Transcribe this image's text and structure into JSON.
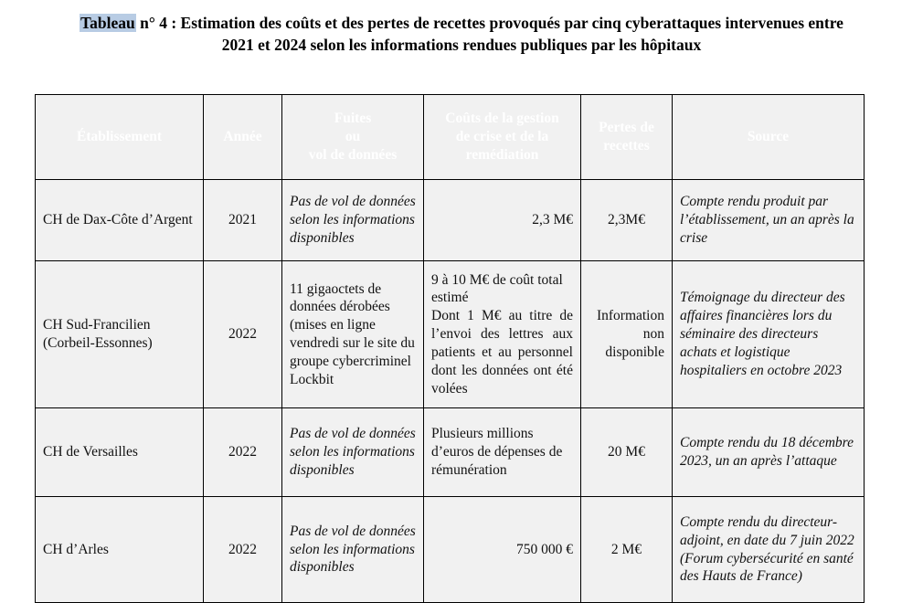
{
  "caption": {
    "highlight_word": "Tableau",
    "rest": " n° 4 :  Estimation des coûts et des pertes de recettes provoqués par cinq cyberattaques intervenues entre 2021 et 2024 selon les informations rendues publiques par les hôpitaux",
    "highlight_color": "#b8cce4"
  },
  "table": {
    "header_bg": "#2d7f84",
    "header_text_color": "#ffffff",
    "cell_bg": "#f1f1f1",
    "border_color": "#000000",
    "columns": [
      {
        "key": "etablissement",
        "label": "Établissement"
      },
      {
        "key": "annee",
        "label": "Année"
      },
      {
        "key": "fuites",
        "label": "Fuites\nou\nvol de données",
        "label_l1": "Fuites",
        "label_l2": "ou",
        "label_l3": "vol de données"
      },
      {
        "key": "couts",
        "label": "Coûts de la gestion de crise et de la remédiation",
        "label_l1": "Coûts de la gestion",
        "label_l2": "de crise et de la",
        "label_l3": "remédiation"
      },
      {
        "key": "pertes",
        "label": "Pertes de recettes",
        "label_l1": "Pertes de",
        "label_l2": "recettes"
      },
      {
        "key": "source",
        "label": "Source"
      }
    ],
    "rows": [
      {
        "etablissement": "CH de Dax-Côte d’Argent",
        "annee": "2021",
        "fuites": "Pas de vol de données selon les informations disponibles",
        "couts": "2,3 M€",
        "pertes": "2,3M€",
        "source": "Compte rendu produit par l’établissement, un an après la crise"
      },
      {
        "etablissement": "CH Sud-Francilien (Corbeil-Essonnes)",
        "annee": "2022",
        "fuites": "11 gigaoctets de données dérobées (mises en ligne vendredi sur le site du groupe cybercriminel Lockbit",
        "couts_l1": "9 à 10 M€ de coût total estimé",
        "couts_l2": "Dont 1 M€ au titre de l’envoi des lettres aux patients et au personnel dont les données ont été volées",
        "pertes": "Information non disponible",
        "source": "Témoignage du directeur des affaires financières lors du séminaire des directeurs achats et logistique hospitaliers en octobre 2023"
      },
      {
        "etablissement": "CH de Versailles",
        "annee": "2022",
        "fuites": "Pas de vol de données selon les informations disponibles",
        "couts": "Plusieurs millions d’euros de dépenses de rémunération",
        "pertes": "20 M€",
        "source": "Compte rendu du 18 décembre 2023, un an après l’attaque"
      },
      {
        "etablissement": "CH d’Arles",
        "annee": "2022",
        "fuites": "Pas de vol de données selon les informations disponibles",
        "couts": "750 000 €",
        "pertes": "2 M€",
        "source": "Compte rendu du directeur-adjoint, en date du 7 juin 2022 (Forum cybersécurité en santé des Hauts de France)"
      }
    ]
  }
}
